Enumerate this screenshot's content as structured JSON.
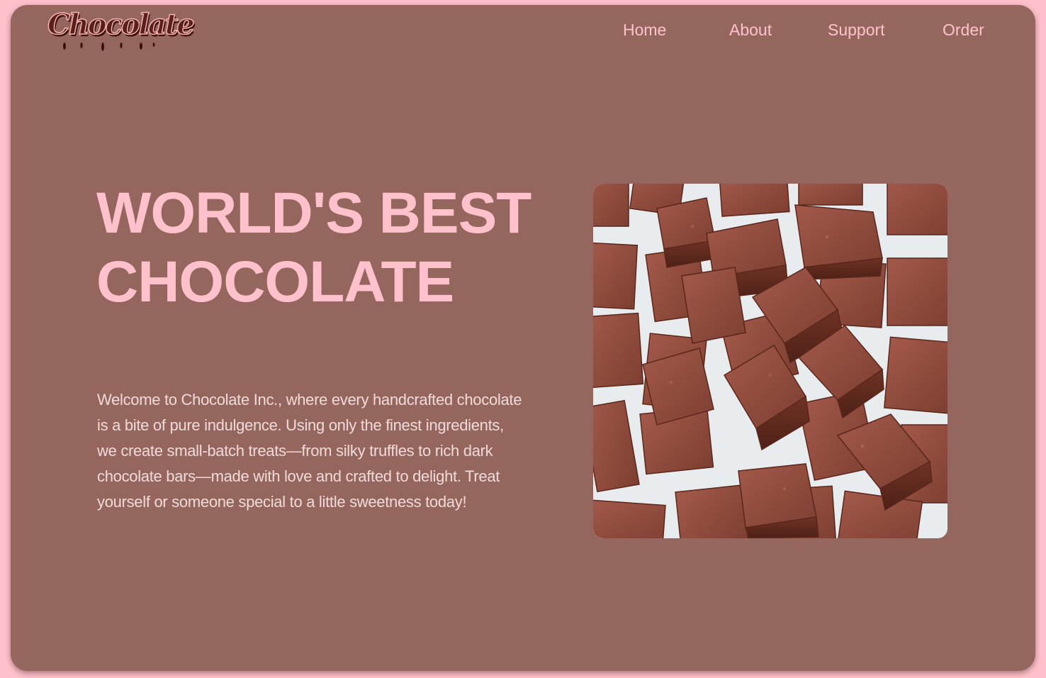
{
  "brand": {
    "logo_text": "Chocolate"
  },
  "nav": {
    "items": [
      {
        "label": "Home"
      },
      {
        "label": "About"
      },
      {
        "label": "Support"
      },
      {
        "label": "Order"
      }
    ]
  },
  "hero": {
    "headline_line1": "WORLD'S BEST",
    "headline_line2": "CHOCOLATE",
    "intro": "Welcome to Chocolate Inc., where every handcrafted chocolate is a bite of pure indulgence. Using only the finest ingredients, we create small-batch treats—from silky truffles to rich dark chocolate bars—made with love and crafted to delight. Treat yourself or someone special to a little sweetness today!"
  },
  "colors": {
    "page_border": "#ffc0cb",
    "card_background": "#94665d",
    "accent_text": "#ffc2cc",
    "body_text": "#f2dada",
    "chocolate": "#8a4a3a"
  }
}
